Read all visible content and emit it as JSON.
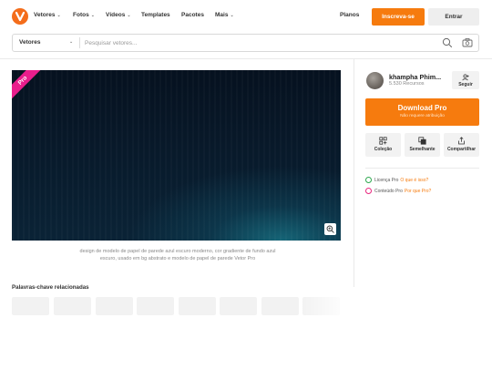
{
  "header": {
    "nav": [
      {
        "label": "Vetores",
        "has_dropdown": true
      },
      {
        "label": "Fotos",
        "has_dropdown": true
      },
      {
        "label": "Vídeos",
        "has_dropdown": true
      },
      {
        "label": "Templates",
        "has_dropdown": false
      },
      {
        "label": "Pacotes",
        "has_dropdown": false
      },
      {
        "label": "Mais",
        "has_dropdown": true
      }
    ],
    "plans_label": "Planos",
    "signup_label": "Inscreva-se",
    "enter_label": "Entrar",
    "brand_color": "#f46d1b"
  },
  "search": {
    "category": "Vetores",
    "placeholder": "Pesquisar vetores..."
  },
  "resource": {
    "badge": "Pro",
    "description": "design de modelo de papel de parede azul escuro moderno, cor gradiente de fundo azul escuro, usado em bg abstrato e modelo de papel de parede Vetor Pro"
  },
  "keywords": {
    "title": "Palavras-chave relacionadas",
    "chips": [
      "",
      "",
      "",
      "",
      "",
      "",
      "",
      ""
    ]
  },
  "author": {
    "name": "khampha Phim...",
    "resources": "5.530 Recursos",
    "follow_label": "Seguir"
  },
  "download": {
    "label": "Download Pro",
    "sublabel": "Não requere atribuição",
    "color": "#f67b0e"
  },
  "actions": [
    {
      "label": "Coleção",
      "icon": "collection-icon"
    },
    {
      "label": "Semelhante",
      "icon": "similar-icon"
    },
    {
      "label": "Compartilhar",
      "icon": "share-icon"
    }
  ],
  "license": {
    "row1_text": "Licença Pro",
    "row1_link": "O que é isso?",
    "row2_text": "Conteúdo Pro",
    "row2_link": "Por que Pro?"
  }
}
